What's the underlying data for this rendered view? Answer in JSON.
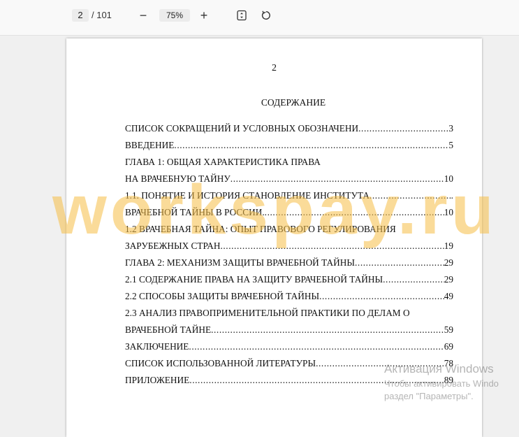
{
  "toolbar": {
    "current_page": "2",
    "total_pages": "/ 101",
    "zoom_out_glyph": "−",
    "zoom_level": "75%",
    "zoom_in_glyph": "+",
    "icons": [
      "fit-page-icon",
      "rotate-icon"
    ]
  },
  "page": {
    "number": "2",
    "heading": "СОДЕРЖАНИЕ",
    "toc": [
      {
        "title": "СПИСОК СОКРАЩЕНИЙ И УСЛОВНЫХ ОБОЗНАЧЕНИ",
        "page": "3"
      },
      {
        "title": "ВВЕДЕНИЕ",
        "page": "5"
      },
      {
        "title": "ГЛАВА 1: ОБЩАЯ ХАРАКТЕРИСТИКА ПРАВА",
        "page": ""
      },
      {
        "title": "НА ВРАЧЕБНУЮ ТАЙНУ",
        "page": "10"
      },
      {
        "title": "1.1.   ПОНЯТИЕ И ИСТОРИЯ СТАНОВЛЕНИЕ ИНСТИТУТА",
        "page": "."
      },
      {
        "title": "ВРАЧЕБНОЙ ТАЙНЫ В РОССИИ.",
        "page": "10"
      },
      {
        "title": "1.2 ВРАЧЕБНАЯ ТАЙНА: ОПЫТ ПРАВОВОГО РЕГУЛИРОВАНИЯ",
        "page": ""
      },
      {
        "title": "ЗАРУБЕЖНЫХ СТРАН",
        "page": "19"
      },
      {
        "title": "ГЛАВА 2: МЕХАНИЗМ ЗАЩИТЫ ВРАЧЕБНОЙ ТАЙНЫ",
        "page": "29"
      },
      {
        "title": "2.1 СОДЕРЖАНИЕ ПРАВА НА ЗАЩИТУ ВРАЧЕБНОЙ ТАЙНЫ",
        "page": "29"
      },
      {
        "title": "2.2 СПОСОБЫ ЗАЩИТЫ ВРАЧЕБНОЙ ТАЙНЫ",
        "page": "49"
      },
      {
        "title": "2.3 АНАЛИЗ ПРАВОПРИМЕНИТЕЛЬНОЙ ПРАКТИКИ ПО ДЕЛАМ О",
        "page": ""
      },
      {
        "title": "ВРАЧЕБНОЙ ТАЙНЕ",
        "page": "59"
      },
      {
        "title": "ЗАКЛЮЧЕНИЕ",
        "page": "69"
      },
      {
        "title": "СПИСОК ИСПОЛЬЗОВАННОЙ ЛИТЕРАТУРЫ",
        "page": "78"
      },
      {
        "title": "ПРИЛОЖЕНИЕ",
        "page": "89"
      }
    ]
  },
  "watermark": "workspay.ru",
  "activation": {
    "line1": "Активация Windows",
    "line2": "Чтобы активировать Windo",
    "line3": "раздел \"Параметры\"."
  }
}
